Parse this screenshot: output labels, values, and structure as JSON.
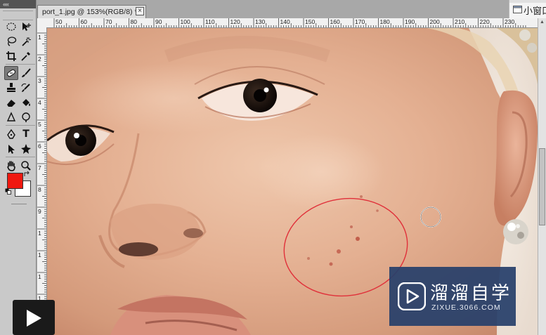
{
  "app": {
    "panel_collapse_glyph": "««",
    "tools": [
      {
        "name": "marquee-tool-icon"
      },
      {
        "name": "move-tool-icon"
      },
      {
        "name": "lasso-tool-icon"
      },
      {
        "name": "magic-wand-tool-icon"
      },
      {
        "name": "crop-tool-icon"
      },
      {
        "name": "eyedropper-tool-icon"
      },
      {
        "name": "healing-brush-tool-icon",
        "active": true
      },
      {
        "name": "brush-tool-icon"
      },
      {
        "name": "clone-stamp-tool-icon"
      },
      {
        "name": "history-brush-tool-icon"
      },
      {
        "name": "eraser-tool-icon"
      },
      {
        "name": "paint-bucket-tool-icon"
      },
      {
        "name": "blur-tool-icon"
      },
      {
        "name": "dodge-tool-icon"
      },
      {
        "name": "pen-tool-icon"
      },
      {
        "name": "type-tool-icon",
        "glyph": "T"
      },
      {
        "name": "path-selection-tool-icon"
      },
      {
        "name": "custom-shape-tool-icon"
      },
      {
        "name": "hand-tool-icon"
      },
      {
        "name": "zoom-tool-icon"
      }
    ],
    "colors": {
      "foreground": "#f01810",
      "background": "#ffffff"
    }
  },
  "document": {
    "tab_title": "port_1.jpg @ 153%(RGB/8) *",
    "close_glyph": "×"
  },
  "side_window": {
    "label": "小窗口"
  },
  "rulers": {
    "horizontal_labels": [
      "50",
      "60",
      "70",
      "80",
      "90",
      "100",
      "110",
      "120",
      "130",
      "140",
      "150",
      "160",
      "170",
      "180",
      "190",
      "200",
      "210",
      "220",
      "230"
    ],
    "vertical_labels": [
      "1",
      "2",
      "3",
      "4",
      "5",
      "6",
      "7",
      "8",
      "9",
      "1",
      "1",
      "1",
      "1",
      "1"
    ]
  },
  "overlay": {
    "play_icon": "play-icon"
  },
  "watermark": {
    "name": "溜溜自学",
    "site": "ZIXUE.3066.COM"
  }
}
